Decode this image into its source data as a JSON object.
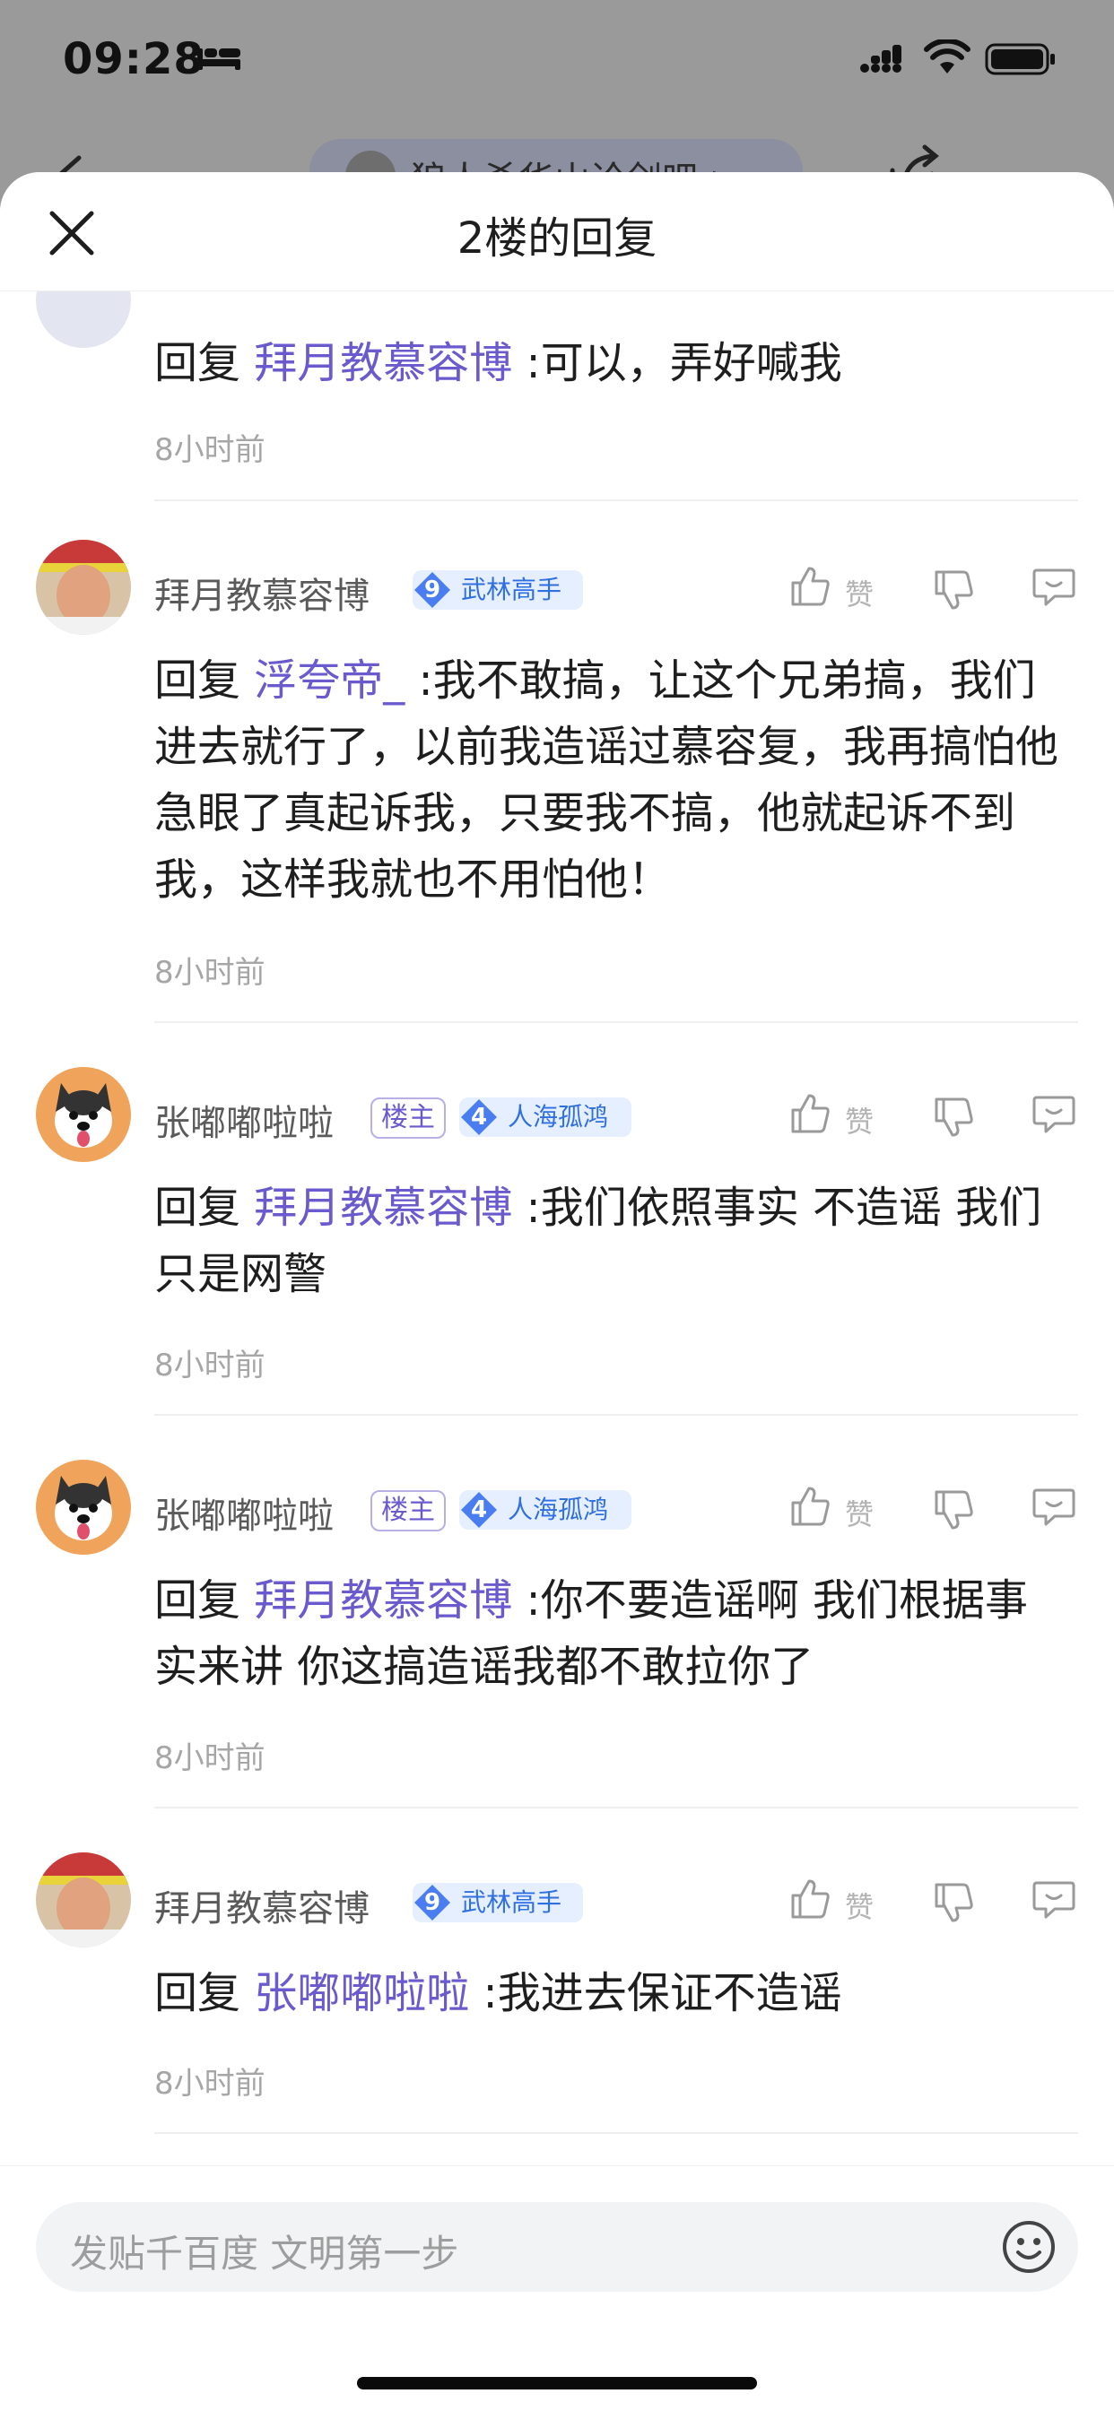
{
  "status_bar": {
    "time": "09:28"
  },
  "background_nav": {
    "forum_name": "狼人杀华山论剑吧 >"
  },
  "sheet": {
    "title": "2楼的回复"
  },
  "first_reply": {
    "prefix": "回复 ",
    "mention": "拜月教慕容博",
    "text": " :可以，弄好喊我",
    "time": "8小时前"
  },
  "replies": [
    {
      "username": "拜月教慕容博",
      "is_owner": false,
      "level": "9",
      "level_title": "武林高手",
      "like_label": "赞",
      "prefix": "回复 ",
      "mention": "浮夸帝_",
      "text": " :我不敢搞，让这个兄弟搞，我们进去就行了，以前我造谣过慕容复，我再搞怕他急眼了真起诉我，只要我不搞，他就起诉不到我，这样我就也不用怕他！",
      "time": "8小时前"
    },
    {
      "username": "张嘟嘟啦啦",
      "is_owner": true,
      "owner_label": "楼主",
      "level": "4",
      "level_title": "人海孤鸿",
      "like_label": "赞",
      "prefix": "回复 ",
      "mention": "拜月教慕容博",
      "text": " :我们依照事实 不造谣 我们只是网警",
      "time": "8小时前"
    },
    {
      "username": "张嘟嘟啦啦",
      "is_owner": true,
      "owner_label": "楼主",
      "level": "4",
      "level_title": "人海孤鸿",
      "like_label": "赞",
      "prefix": "回复 ",
      "mention": "拜月教慕容博",
      "text": " :你不要造谣啊 我们根据事实来讲 你这搞造谣我都不敢拉你了",
      "time": "8小时前"
    },
    {
      "username": "拜月教慕容博",
      "is_owner": false,
      "level": "9",
      "level_title": "武林高手",
      "like_label": "赞",
      "prefix": "回复 ",
      "mention": "张嘟嘟啦啦",
      "text": " :我进去保证不造谣",
      "time": "8小时前"
    }
  ],
  "input": {
    "placeholder": "发贴千百度 文明第一步"
  },
  "colors": {
    "mention": "#6a5acd",
    "level_badge_bg": "#e5efff",
    "level_text": "#2f6fe0",
    "time_text": "#a6a6a6"
  }
}
